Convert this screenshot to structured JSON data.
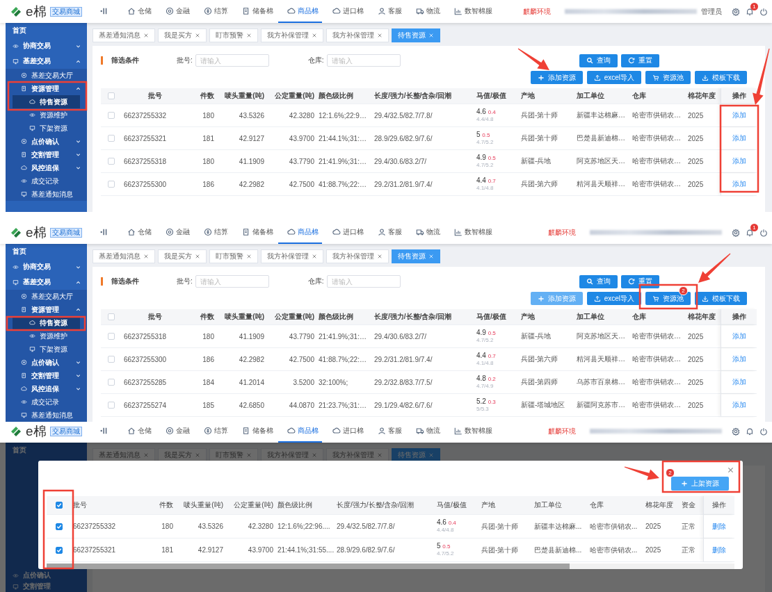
{
  "panels": [
    {
      "kind": "list",
      "header": {
        "logo": "e棉",
        "logo_tag": "交易商城",
        "nav": [
          {
            "label": "仓储",
            "selected": false
          },
          {
            "label": "金融",
            "selected": false
          },
          {
            "label": "结算",
            "selected": false
          },
          {
            "label": "储备棉",
            "selected": false
          },
          {
            "label": "商品棉",
            "selected": true
          },
          {
            "label": "进口棉",
            "selected": false
          },
          {
            "label": "客服",
            "selected": false
          },
          {
            "label": "物流",
            "selected": false
          },
          {
            "label": "数智棉服",
            "selected": false
          }
        ],
        "environment": "麒麟环境",
        "user": "管理员",
        "notification_count": "1"
      },
      "sidebar": {
        "home": "首页",
        "items": [
          {
            "kind": "group",
            "label": "协商交易",
            "expanded": false
          },
          {
            "kind": "group",
            "label": "基差交易",
            "expanded": true,
            "children": [
              {
                "kind": "link",
                "label": "基差交易大厅",
                "selected": false
              },
              {
                "kind": "group",
                "label": "资源管理",
                "expanded": true,
                "children": [
                  {
                    "kind": "link",
                    "label": "待售资源",
                    "selected": true
                  },
                  {
                    "kind": "link",
                    "label": "资源维护",
                    "selected": false
                  },
                  {
                    "kind": "link",
                    "label": "下架资源",
                    "selected": false
                  }
                ]
              },
              {
                "kind": "group",
                "label": "点价确认",
                "expanded": false
              },
              {
                "kind": "group",
                "label": "交割管理",
                "expanded": false
              },
              {
                "kind": "group",
                "label": "风控追保",
                "expanded": false
              },
              {
                "kind": "link",
                "label": "成交记录",
                "selected": false
              },
              {
                "kind": "link",
                "label": "基差通知消息",
                "selected": false
              }
            ]
          }
        ]
      },
      "tabs": [
        {
          "label": "基差通知消息",
          "selected": false
        },
        {
          "label": "我是买方",
          "selected": false
        },
        {
          "label": "盯市预警",
          "selected": false
        },
        {
          "label": "我方补保管理",
          "selected": false
        },
        {
          "label": "我方补保管理",
          "selected": false
        },
        {
          "label": "待售资源",
          "selected": true
        }
      ],
      "filter": {
        "title": "筛选条件",
        "fields": [
          {
            "label": "批号:",
            "placeholder": "请输入"
          },
          {
            "label": "仓库:",
            "placeholder": "请输入"
          }
        ]
      },
      "search_buttons": [
        {
          "label": "查询"
        },
        {
          "label": "重置"
        }
      ],
      "action_buttons": [
        {
          "label": "添加资源",
          "disabled": false
        },
        {
          "label": "excel导入",
          "disabled": false
        },
        {
          "label": "资源池",
          "disabled": false
        },
        {
          "label": "模板下载",
          "disabled": false
        }
      ],
      "table": {
        "select_all_checked": false,
        "columns": [
          "批号",
          "件数",
          "唛头重量(吨)",
          "公定重量(吨)",
          "颜色级比例",
          "长度/强力/长整/含杂/回潮",
          "马值/极值",
          "产地",
          "加工单位",
          "仓库",
          "棉花年度",
          "操作"
        ],
        "rows": [
          {
            "checked": false,
            "batch": "66237255332",
            "count": "180",
            "mark_weight": "43.5326",
            "official_weight": "42.3280",
            "color_grade": "12:1.6%;22:9…",
            "quality": "29.4/32.5/82.7/7.8/",
            "mic": "4.6",
            "mic_spread": "0.4",
            "mic_range": "4.4/4.8",
            "origin": "兵团-第十师",
            "processor": "新疆丰达棉麻…",
            "warehouse": "哈密市供销农…",
            "year": "2025",
            "action": "添加"
          },
          {
            "checked": false,
            "batch": "66237255321",
            "count": "181",
            "mark_weight": "42.9127",
            "official_weight": "43.9700",
            "color_grade": "21:44.1%;31:…",
            "quality": "28.9/29.6/82.9/7.6/",
            "mic": "5",
            "mic_spread": "0.5",
            "mic_range": "4.7/5.2",
            "origin": "兵团-第十师",
            "processor": "巴楚县新迪棉…",
            "warehouse": "哈密市供销农…",
            "year": "2025",
            "action": "添加"
          },
          {
            "checked": false,
            "batch": "66237255318",
            "count": "180",
            "mark_weight": "41.1909",
            "official_weight": "43.7790",
            "color_grade": "21:41.9%;31:…",
            "quality": "29.4/30.6/83.2/7/",
            "mic": "4.9",
            "mic_spread": "0.5",
            "mic_range": "4.7/5.2",
            "origin": "新疆-兵地",
            "processor": "阿克苏地区天…",
            "warehouse": "哈密市供销农…",
            "year": "2025",
            "action": "添加"
          },
          {
            "checked": false,
            "batch": "66237255300",
            "count": "186",
            "mark_weight": "42.2982",
            "official_weight": "42.7500",
            "color_grade": "41:88.7%;22:…",
            "quality": "29.2/31.2/81.9/7.4/",
            "mic": "4.4",
            "mic_spread": "0.7",
            "mic_range": "4.1/4.8",
            "origin": "兵团-第六师",
            "processor": "精河县天顺祥…",
            "warehouse": "哈密市供销农…",
            "year": "2025",
            "action": "添加"
          }
        ]
      }
    },
    {
      "kind": "list",
      "header": {
        "logo": "e棉",
        "logo_tag": "交易商城",
        "nav": [
          {
            "label": "仓储",
            "selected": false
          },
          {
            "label": "金融",
            "selected": false
          },
          {
            "label": "结算",
            "selected": false
          },
          {
            "label": "储备棉",
            "selected": false
          },
          {
            "label": "商品棉",
            "selected": true
          },
          {
            "label": "进口棉",
            "selected": false
          },
          {
            "label": "客服",
            "selected": false
          },
          {
            "label": "物流",
            "selected": false
          },
          {
            "label": "数智棉服",
            "selected": false
          }
        ],
        "environment": "麒麟环境",
        "notification_count": "1"
      },
      "sidebar": {
        "home": "首页",
        "items": [
          {
            "kind": "group",
            "label": "协商交易",
            "expanded": false
          },
          {
            "kind": "group",
            "label": "基差交易",
            "expanded": true,
            "children": [
              {
                "kind": "link",
                "label": "基差交易大厅",
                "selected": false
              },
              {
                "kind": "group",
                "label": "资源管理",
                "expanded": true,
                "children": [
                  {
                    "kind": "link",
                    "label": "待售资源",
                    "selected": true
                  },
                  {
                    "kind": "link",
                    "label": "资源维护",
                    "selected": false
                  },
                  {
                    "kind": "link",
                    "label": "下架资源",
                    "selected": false
                  }
                ]
              },
              {
                "kind": "group",
                "label": "点价确认",
                "expanded": false
              },
              {
                "kind": "group",
                "label": "交割管理",
                "expanded": false
              },
              {
                "kind": "group",
                "label": "风控追保",
                "expanded": false
              },
              {
                "kind": "link",
                "label": "成交记录",
                "selected": false
              },
              {
                "kind": "link",
                "label": "基差通知消息",
                "selected": false
              }
            ]
          }
        ]
      },
      "tabs": [
        {
          "label": "基差通知消息",
          "selected": false
        },
        {
          "label": "我是买方",
          "selected": false
        },
        {
          "label": "盯市预警",
          "selected": false
        },
        {
          "label": "我方补保管理",
          "selected": false
        },
        {
          "label": "我方补保管理",
          "selected": false
        },
        {
          "label": "待售资源",
          "selected": true
        }
      ],
      "filter": {
        "title": "筛选条件",
        "fields": [
          {
            "label": "批号:",
            "placeholder": "请输入"
          },
          {
            "label": "仓库:",
            "placeholder": "请输入"
          }
        ]
      },
      "search_buttons": [
        {
          "label": "查询"
        },
        {
          "label": "重置"
        }
      ],
      "action_buttons": [
        {
          "label": "添加资源",
          "disabled": true
        },
        {
          "label": "excel导入",
          "disabled": false
        },
        {
          "label": "资源池",
          "disabled": false,
          "badge": "2"
        },
        {
          "label": "模板下载",
          "disabled": false
        }
      ],
      "table": {
        "select_all_checked": false,
        "columns": [
          "批号",
          "件数",
          "唛头重量(吨)",
          "公定重量(吨)",
          "颜色级比例",
          "长度/强力/长整/含杂/回潮",
          "马值/极值",
          "产地",
          "加工单位",
          "仓库",
          "棉花年度",
          "操作"
        ],
        "rows": [
          {
            "checked": false,
            "batch": "66237255318",
            "count": "180",
            "mark_weight": "41.1909",
            "official_weight": "43.7790",
            "color_grade": "21:41.9%;31:…",
            "quality": "29.4/30.6/83.2/7/",
            "mic": "4.9",
            "mic_spread": "0.5",
            "mic_range": "4.7/5.2",
            "origin": "新疆-兵地",
            "processor": "阿克苏地区天…",
            "warehouse": "哈密市供销农…",
            "year": "2025",
            "action": "添加"
          },
          {
            "checked": false,
            "batch": "66237255300",
            "count": "186",
            "mark_weight": "42.2982",
            "official_weight": "42.7500",
            "color_grade": "41:88.7%;22:…",
            "quality": "29.2/31.2/81.9/7.4/",
            "mic": "4.4",
            "mic_spread": "0.7",
            "mic_range": "4.1/4.8",
            "origin": "兵团-第六师",
            "processor": "精河县天顺祥…",
            "warehouse": "哈密市供销农…",
            "year": "2025",
            "action": "添加"
          },
          {
            "checked": false,
            "batch": "66237255285",
            "count": "184",
            "mark_weight": "41.2014",
            "official_weight": "3.5200",
            "color_grade": "32:100%;",
            "quality": "29.2/32.8/83.7/7.5/",
            "mic": "4.8",
            "mic_spread": "0.2",
            "mic_range": "4.7/4.9",
            "origin": "兵团-第四师",
            "processor": "乌苏市百泉棉…",
            "warehouse": "哈密市供销农…",
            "year": "2025",
            "action": "添加"
          },
          {
            "checked": false,
            "batch": "66237255274",
            "count": "185",
            "mark_weight": "42.6850",
            "official_weight": "44.0870",
            "color_grade": "21:23.7%;31:…",
            "quality": "29.1/29.4/82.6/7.6/",
            "mic": "5.2",
            "mic_spread": "0.3",
            "mic_range": "5/5.3",
            "origin": "新疆-塔城地区",
            "processor": "新疆阿克苏市…",
            "warehouse": "哈密市供销农…",
            "year": "2025",
            "action": "添加"
          }
        ]
      }
    },
    {
      "kind": "modal",
      "header": {
        "logo": "e棉",
        "logo_tag": "交易商城",
        "nav": [
          {
            "label": "仓储",
            "selected": false
          },
          {
            "label": "金融",
            "selected": false
          },
          {
            "label": "结算",
            "selected": false
          },
          {
            "label": "储备棉",
            "selected": false
          },
          {
            "label": "商品棉",
            "selected": true
          },
          {
            "label": "进口棉",
            "selected": false
          },
          {
            "label": "客服",
            "selected": false
          },
          {
            "label": "物流",
            "selected": false
          },
          {
            "label": "数智棉服",
            "selected": false
          }
        ],
        "environment": "麒麟环境"
      },
      "sidebar": {
        "home": "首页",
        "items": [
          {
            "kind": "group",
            "label": "点价确认"
          },
          {
            "kind": "group",
            "label": "交割管理"
          }
        ]
      },
      "tabs": [
        {
          "label": "基差通知消息",
          "selected": false
        },
        {
          "label": "我是买方",
          "selected": false
        },
        {
          "label": "盯市预警",
          "selected": false
        },
        {
          "label": "我方补保管理",
          "selected": false
        },
        {
          "label": "我方补保管理",
          "selected": false
        },
        {
          "label": "待售资源",
          "selected": true
        }
      ],
      "modal": {
        "submit": {
          "label": "上架资源",
          "badge": "2"
        },
        "table": {
          "select_all_checked": true,
          "columns": [
            "批号",
            "件数",
            "唛头重量(吨)",
            "公定重量(吨)",
            "颜色级比例",
            "长度/强力/长整/含杂/回潮",
            "马值/极值",
            "产地",
            "加工单位",
            "仓库",
            "棉花年度",
            "资金",
            "操作"
          ],
          "rows": [
            {
              "checked": true,
              "batch": "66237255332",
              "count": "180",
              "mark_weight": "43.5326",
              "official_weight": "42.3280",
              "color_grade": "12:1.6%;22:96....",
              "quality": "29.4/32.5/82.7/7.8/",
              "mic": "4.6",
              "mic_spread": "0.4",
              "mic_range": "4.4/4.8",
              "origin": "兵团-第十师",
              "processor": "新疆丰达棉麻...",
              "warehouse": "哈密市供销农...",
              "year": "2025",
              "fund": "正常",
              "action": "删除"
            },
            {
              "checked": true,
              "batch": "66237255321",
              "count": "181",
              "mark_weight": "42.9127",
              "official_weight": "43.9700",
              "color_grade": "21:44.1%;31:55....",
              "quality": "28.9/29.6/82.9/7.6/",
              "mic": "5",
              "mic_spread": "0.5",
              "mic_range": "4.7/5.2",
              "origin": "兵团-第十师",
              "processor": "巴楚县新迪棉...",
              "warehouse": "哈密市供销农...",
              "year": "2025",
              "fund": "正常",
              "action": "删除"
            }
          ]
        }
      }
    }
  ]
}
